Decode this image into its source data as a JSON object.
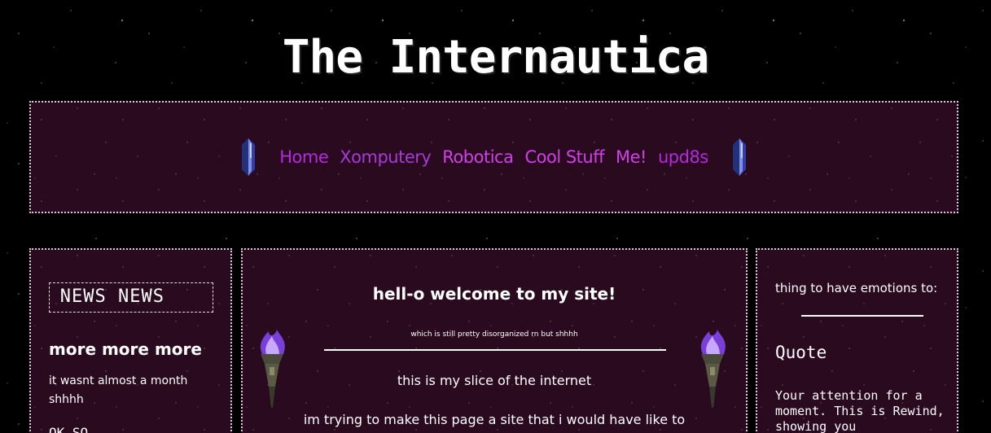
{
  "site": {
    "title": "The Internautica"
  },
  "nav": {
    "items": [
      {
        "label": "Home",
        "color": "#b52ae0"
      },
      {
        "label": "Xomputery",
        "color": "#a83ad8"
      },
      {
        "label": "Robotica",
        "color": "#d040e8"
      },
      {
        "label": "Cool Stuff",
        "color": "#d040e8"
      },
      {
        "label": "Me!",
        "color": "#d040e8"
      },
      {
        "label": "upd8s",
        "color": "#b52ae0"
      }
    ],
    "left_icon": "blue-gem-icon",
    "right_icon": "blue-gem-icon"
  },
  "left": {
    "ticker": "WS NEWS NEWS",
    "heading": "more more more",
    "text": "it wasnt almost a month shhhh",
    "more": "OK SO"
  },
  "main": {
    "title": "hell-o welcome to my site!",
    "subtitle": "which is still pretty disorganized rn but shhhh",
    "line1": "this is my slice of the internet",
    "line2": "im trying to make this page a site that i would have like to",
    "left_icon": "purple-flame-torch-icon",
    "right_icon": "purple-flame-torch-icon"
  },
  "right": {
    "emotion_text": "thing to have emotions to:",
    "quote_heading": "Quote",
    "quote_text": "Your attention for a moment. This is Rewind, showing you"
  },
  "colors": {
    "panel_bg": "#2a0a1f",
    "nav_link": "#b52ae0",
    "page_bg": "#000000"
  }
}
